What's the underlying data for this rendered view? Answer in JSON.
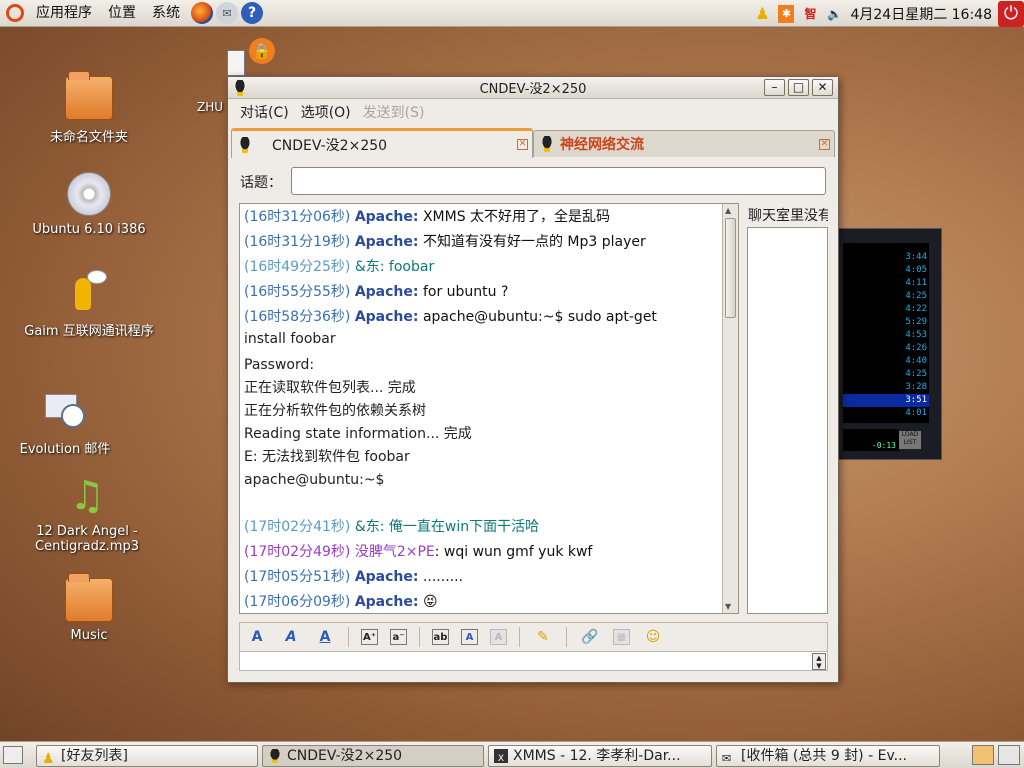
{
  "top_panel": {
    "menus": [
      "应用程序",
      "位置",
      "系统"
    ],
    "clock": "4月24日星期二 16:48",
    "tray_text": "智"
  },
  "desktop": {
    "icons": [
      {
        "label": "未命名文件夹",
        "icon": "folder-icon"
      },
      {
        "label": "Ubuntu 6.10 i386",
        "icon": "cdrom-icon"
      },
      {
        "label": "Gaim 互联网通讯程序",
        "icon": "gaim-icon"
      },
      {
        "label": "Evolution 邮件",
        "icon": "evolution-icon"
      },
      {
        "label": "12 Dark Angel - Centigradz.mp3",
        "icon": "music-note-icon"
      },
      {
        "label": "Music",
        "icon": "folder-icon"
      }
    ],
    "partial_label": "ZHU"
  },
  "window": {
    "title": "CNDEV-没2×250",
    "menus": [
      {
        "label": "对话(C)",
        "enabled": true
      },
      {
        "label": "选项(O)",
        "enabled": true
      },
      {
        "label": "发送到(S)",
        "enabled": false
      }
    ],
    "tabs": [
      {
        "label": "CNDEV-没2×250",
        "active": true
      },
      {
        "label": "神经网络交流",
        "active": false
      }
    ],
    "topic_label": "话题：",
    "topic_value": "",
    "members_label": "聊天室里没有",
    "compose_value": ""
  },
  "messages": [
    {
      "ts": "(16时31分06秒)",
      "who": "Apache:",
      "text": "XMMS 太不好用了，全是乱码"
    },
    {
      "ts": "(16时31分19秒)",
      "who": "Apache:",
      "text": "不知道有没有好一点的 Mp3 player"
    },
    {
      "ts": "(16时49分25秒)",
      "who": "&东:",
      "text": "foobar"
    },
    {
      "ts": "(16时55分55秒)",
      "who": "Apache:",
      "text": "for ubuntu ?"
    },
    {
      "ts": "(16时58分36秒)",
      "who": "Apache:",
      "text": "apache@ubuntu:~$ sudo apt-get"
    },
    {
      "cont": "install foobar"
    },
    {
      "plain": "Password:"
    },
    {
      "plain": "正在读取软件包列表... 完成"
    },
    {
      "plain": "正在分析软件包的依赖关系树"
    },
    {
      "plain": "Reading state information... 完成"
    },
    {
      "plain": "E: 无法找到软件包 foobar"
    },
    {
      "plain": "apache@ubuntu:~$"
    },
    {
      "plain": ""
    },
    {
      "ts": "(17时02分41秒)",
      "who": "&东:",
      "text": "俺一直在win下面干活哈"
    },
    {
      "ts": "(17时02分49秒)",
      "who": "没脾气2×PE",
      "text": ": wqi wun gmf yuk kwf"
    },
    {
      "ts": "(17时05分51秒)",
      "who": "Apache:",
      "text": "........."
    },
    {
      "ts": "(17时06分09秒)",
      "who": "Apache:",
      "text": "😝"
    }
  ],
  "xmms": {
    "times": [
      "3:44",
      "4:05",
      "4:11",
      "4:25",
      "4:22",
      "5:29",
      "4:53",
      "4:26",
      "4:40",
      "4:25",
      "3:28",
      "3:51",
      "4:01"
    ],
    "selected_index": 11,
    "counter": "-0:13",
    "button": "LOAD LIST",
    "marker": "99"
  },
  "taskbar": {
    "tasks": [
      "[好友列表]",
      "CNDEV-没2×250",
      "XMMS - 12. 李孝利-Dar...",
      "[收件箱 (总共 9 封) - Ev..."
    ]
  }
}
